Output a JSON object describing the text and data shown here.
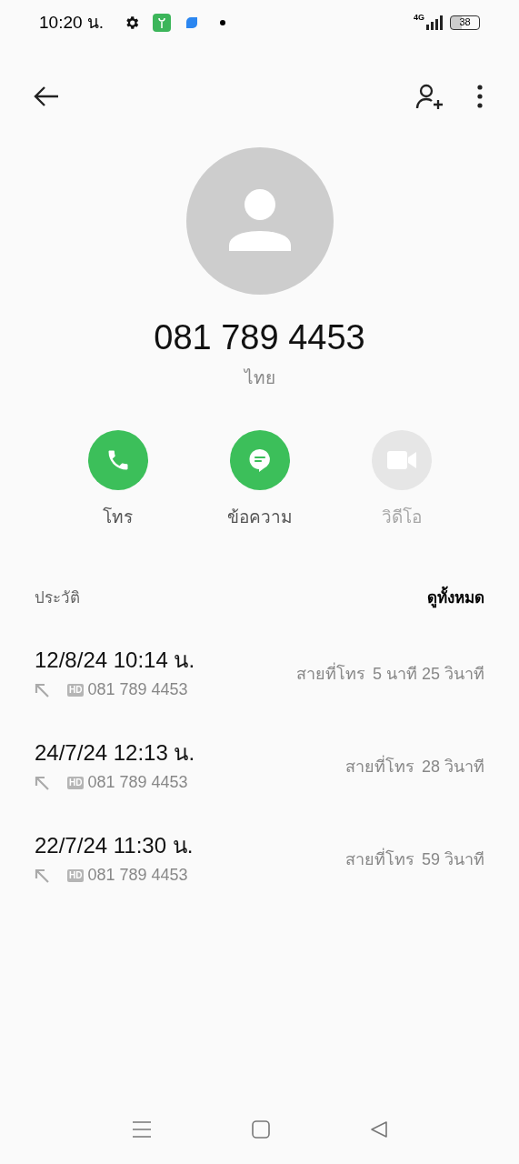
{
  "status_bar": {
    "time": "10:20 น.",
    "network": "4G",
    "battery": "38"
  },
  "contact": {
    "number": "081 789 4453",
    "location": "ไทย"
  },
  "actions": [
    {
      "kind": "call",
      "label": "โทร",
      "disabled": false
    },
    {
      "kind": "message",
      "label": "ข้อความ",
      "disabled": false
    },
    {
      "kind": "video",
      "label": "วิดีโอ",
      "disabled": true
    }
  ],
  "history": {
    "title": "ประวัติ",
    "see_all": "ดูทั้งหมด",
    "calls": [
      {
        "datetime": "12/8/24 10:14 น.",
        "badge": "HD",
        "number": "081 789 4453",
        "type": "สายที่โทร",
        "duration": "5 นาที 25 วินาที"
      },
      {
        "datetime": "24/7/24 12:13 น.",
        "badge": "HD",
        "number": "081 789 4453",
        "type": "สายที่โทร",
        "duration": "28 วินาที"
      },
      {
        "datetime": "22/7/24 11:30 น.",
        "badge": "HD",
        "number": "081 789 4453",
        "type": "สายที่โทร",
        "duration": "59 วินาที"
      }
    ]
  }
}
